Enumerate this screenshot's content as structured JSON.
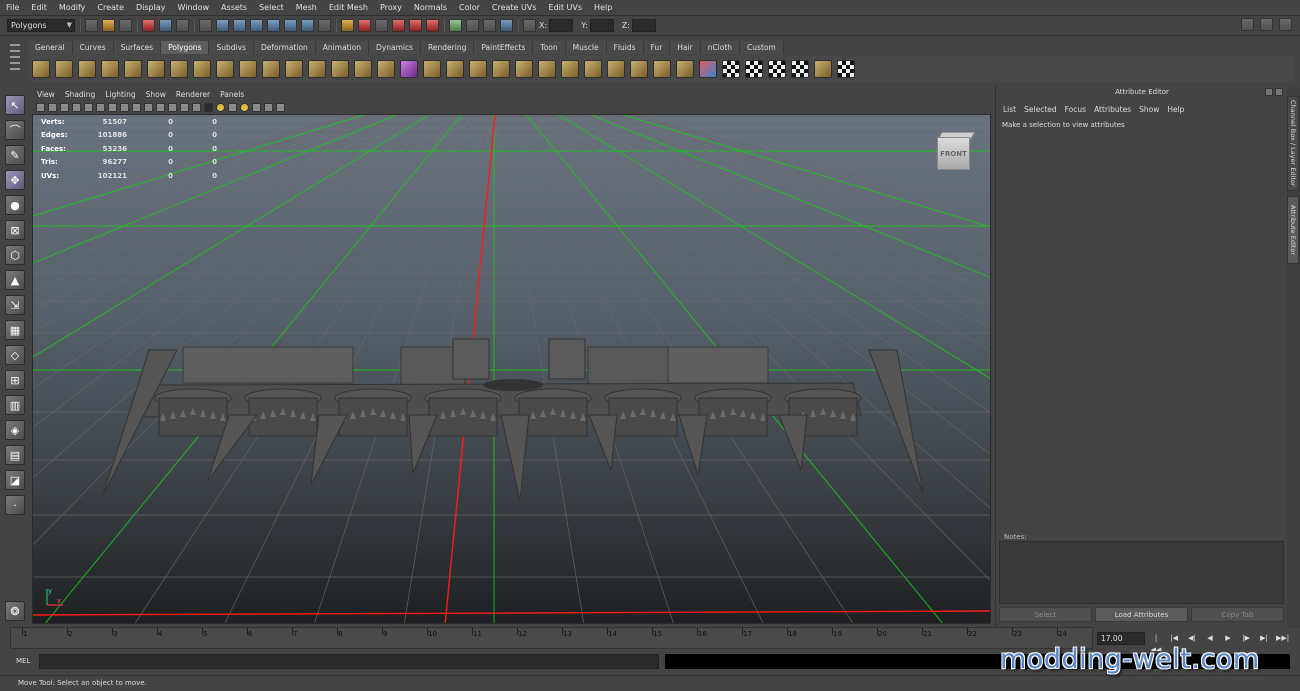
{
  "menubar": [
    "File",
    "Edit",
    "Modify",
    "Create",
    "Display",
    "Window",
    "Assets",
    "Select",
    "Mesh",
    "Edit Mesh",
    "Proxy",
    "Normals",
    "Color",
    "Create UVs",
    "Edit UVs",
    "Help"
  ],
  "status": {
    "mode": "Polygons",
    "x_label": "X:",
    "y_label": "Y:",
    "z_label": "Z:"
  },
  "shelf_tabs": [
    "General",
    "Curves",
    "Surfaces",
    "Polygons",
    "Subdivs",
    "Deformation",
    "Animation",
    "Dynamics",
    "Rendering",
    "PaintEffects",
    "Toon",
    "Muscle",
    "Fluids",
    "Fur",
    "Hair",
    "nCloth",
    "Custom"
  ],
  "shelf_active_tab": "Polygons",
  "viewport": {
    "menu": [
      "View",
      "Shading",
      "Lighting",
      "Show",
      "Renderer",
      "Panels"
    ],
    "hud": [
      {
        "label": "Verts:",
        "value": "51507",
        "sel": "0",
        "uv": "0"
      },
      {
        "label": "Edges:",
        "value": "101886",
        "sel": "0",
        "uv": "0"
      },
      {
        "label": "Faces:",
        "value": "53236",
        "sel": "0",
        "uv": "0"
      },
      {
        "label": "Tris:",
        "value": "96277",
        "sel": "0",
        "uv": "0"
      },
      {
        "label": "UVs:",
        "value": "102121",
        "sel": "0",
        "uv": "0"
      }
    ],
    "viewcube_label": "FRONT",
    "colors": {
      "grid_major": "#19c819",
      "axis_y": "#ff1a1a",
      "axis_x": "#ff1a1a",
      "grid_minor": "#6a6a6a"
    }
  },
  "attribute_editor": {
    "title": "Attribute Editor",
    "menu": [
      "List",
      "Selected",
      "Focus",
      "Attributes",
      "Show",
      "Help"
    ],
    "message": "Make a selection to view attributes",
    "notes_label": "Notes:",
    "buttons": [
      "Select",
      "Load Attributes",
      "Copy Tab"
    ]
  },
  "side_tabs": [
    "Channel Box / Layer Editor",
    "Attribute Editor"
  ],
  "timeline": {
    "ticks": [
      "1",
      "2",
      "3",
      "4",
      "5",
      "6",
      "7",
      "8",
      "9",
      "10",
      "11",
      "12",
      "13",
      "14",
      "15",
      "16",
      "17",
      "18",
      "19",
      "20",
      "21",
      "22",
      "23",
      "24"
    ],
    "current_time": "17.00"
  },
  "command_line": {
    "label": "MEL"
  },
  "help_line": "Move Tool: Select an object to move.",
  "watermark": "modding-welt.com"
}
